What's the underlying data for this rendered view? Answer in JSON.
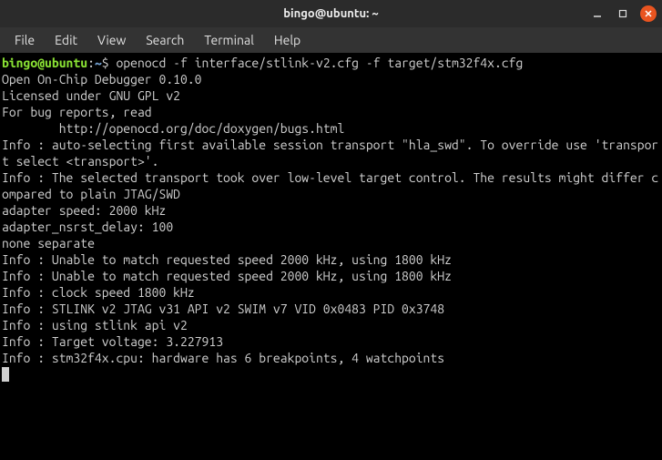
{
  "window": {
    "title": "bingo@ubuntu: ~"
  },
  "menu": {
    "file": "File",
    "edit": "Edit",
    "view": "View",
    "search": "Search",
    "terminal": "Terminal",
    "help": "Help"
  },
  "prompt": {
    "userhost": "bingo@ubuntu",
    "separator": ":",
    "path": "~",
    "symbol": "$"
  },
  "command": " openocd -f interface/stlink-v2.cfg -f target/stm32f4x.cfg",
  "output": {
    "l1": "Open On-Chip Debugger 0.10.0",
    "l2": "Licensed under GNU GPL v2",
    "l3": "For bug reports, read",
    "l4": "        http://openocd.org/doc/doxygen/bugs.html",
    "l5": "Info : auto-selecting first available session transport \"hla_swd\". To override use 'transport select <transport>'.",
    "l6": "Info : The selected transport took over low-level target control. The results might differ compared to plain JTAG/SWD",
    "l7": "adapter speed: 2000 kHz",
    "l8": "adapter_nsrst_delay: 100",
    "l9": "none separate",
    "l10": "Info : Unable to match requested speed 2000 kHz, using 1800 kHz",
    "l11": "Info : Unable to match requested speed 2000 kHz, using 1800 kHz",
    "l12": "Info : clock speed 1800 kHz",
    "l13": "Info : STLINK v2 JTAG v31 API v2 SWIM v7 VID 0x0483 PID 0x3748",
    "l14": "Info : using stlink api v2",
    "l15": "Info : Target voltage: 3.227913",
    "l16": "Info : stm32f4x.cpu: hardware has 6 breakpoints, 4 watchpoints"
  }
}
